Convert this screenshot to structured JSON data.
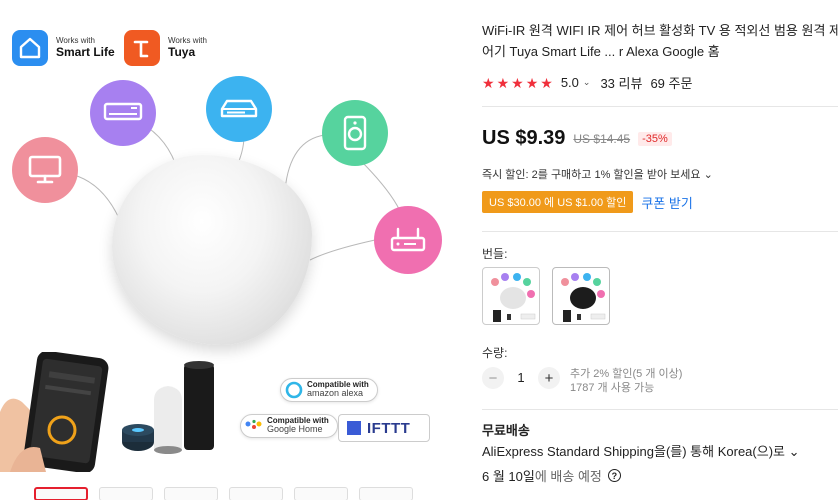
{
  "gallery": {
    "brands": [
      {
        "small": "Works with",
        "big": "Smart Life",
        "color": "#2b8ef0",
        "icon": "smart-life-logo"
      },
      {
        "small": "Works with",
        "big": "Tuya",
        "color": "#f05a22",
        "icon": "tuya-logo"
      }
    ],
    "devices": [
      {
        "icon": "monitor-icon",
        "color": "#f0909c"
      },
      {
        "icon": "air-conditioner-icon",
        "color": "#a780f0"
      },
      {
        "icon": "set-top-box-icon",
        "color": "#3cb3f0"
      },
      {
        "icon": "speaker-icon",
        "color": "#56d39e"
      },
      {
        "icon": "router-icon",
        "color": "#f06fb0"
      }
    ],
    "compat_alexa": {
      "top": "Compatible with",
      "bottom": "amazon alexa"
    },
    "compat_google": {
      "top": "Compatible with",
      "bottom": "Google Home"
    },
    "ifttt": "IFTTT",
    "thumbnail_count": 6
  },
  "product": {
    "title": "WiFi-IR 원격 WIFI IR 제어 허브 활성화 TV 용 적외선 범용 원격 제어기 Tuya Smart Life ... r Alexa Google 홈",
    "rating": "5.0",
    "reviews": "33 리뷰",
    "orders": "69 주문",
    "price": "US $9.39",
    "old_price": "US $14.45",
    "discount": "-35%",
    "instant_discount": "즉시 할인: 2를 구매하고 1% 할인을 받아 보세요",
    "coupon": "US $30.00 에 US $1.00 할인",
    "coupon_link": "쿠폰 받기",
    "bundle_label": "번들:",
    "quantity_label": "수량:",
    "quantity": "1",
    "quantity_note_1": "추가 2% 할인(5 개 이상)",
    "quantity_note_2": "1787 개 사용 가능",
    "shipping_title": "무료배송",
    "shipping_method": "AliExpress Standard Shipping을(를) 통해 Korea(으)로",
    "shipping_date": "6 월 10일",
    "shipping_date_suffix": "에 배송 예정",
    "colors": {
      "accent": "#e5202e",
      "star": "#f0303c",
      "coupon": "#f09a1a",
      "link": "#1a73e8"
    }
  }
}
